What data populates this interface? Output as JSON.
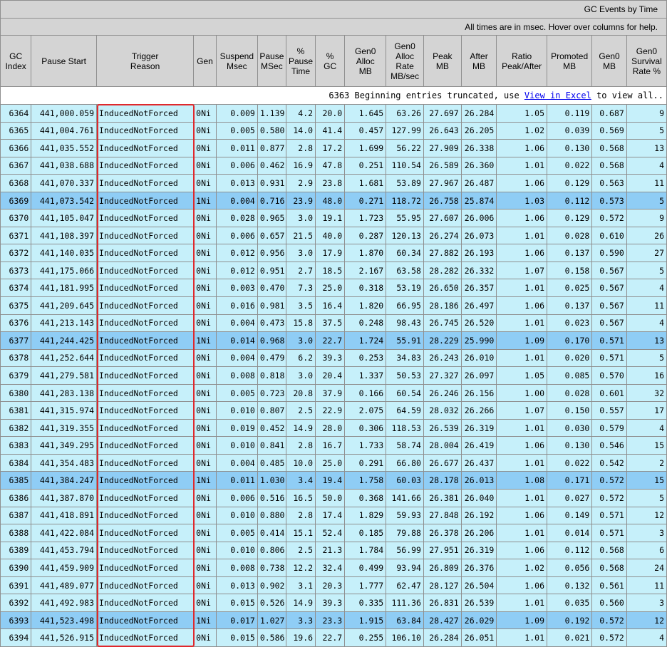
{
  "header": {
    "title": "GC Events by Time",
    "subtitle": "All times are in msec. Hover over columns for help."
  },
  "columns": [
    "GC\nIndex",
    "Pause Start",
    "Trigger\nReason",
    "Gen",
    "Suspend\nMsec",
    "Pause\nMSec",
    "%\nPause\nTime",
    "%\nGC",
    "Gen0\nAlloc\nMB",
    "Gen0\nAlloc\nRate\nMB/sec",
    "Peak\nMB",
    "After\nMB",
    "Ratio\nPeak/After",
    "Promoted\nMB",
    "Gen0\nMB",
    "Gen0\nSurvival\nRate %"
  ],
  "note": {
    "prefix": "6363 Beginning entries truncated, use ",
    "link": "View in Excel",
    "suffix": " to view all.."
  },
  "rows": [
    [
      "6364",
      "441,000.059",
      "InducedNotForced",
      "0Ni",
      "0.009",
      "1.139",
      "4.2",
      "20.0",
      "1.645",
      "63.26",
      "27.697",
      "26.284",
      "1.05",
      "0.119",
      "0.687",
      "9"
    ],
    [
      "6365",
      "441,004.761",
      "InducedNotForced",
      "0Ni",
      "0.005",
      "0.580",
      "14.0",
      "41.4",
      "0.457",
      "127.99",
      "26.643",
      "26.205",
      "1.02",
      "0.039",
      "0.569",
      "5"
    ],
    [
      "6366",
      "441,035.552",
      "InducedNotForced",
      "0Ni",
      "0.011",
      "0.877",
      "2.8",
      "17.2",
      "1.699",
      "56.22",
      "27.909",
      "26.338",
      "1.06",
      "0.130",
      "0.568",
      "13"
    ],
    [
      "6367",
      "441,038.688",
      "InducedNotForced",
      "0Ni",
      "0.006",
      "0.462",
      "16.9",
      "47.8",
      "0.251",
      "110.54",
      "26.589",
      "26.360",
      "1.01",
      "0.022",
      "0.568",
      "4"
    ],
    [
      "6368",
      "441,070.337",
      "InducedNotForced",
      "0Ni",
      "0.013",
      "0.931",
      "2.9",
      "23.8",
      "1.681",
      "53.89",
      "27.967",
      "26.487",
      "1.06",
      "0.129",
      "0.563",
      "11"
    ],
    [
      "6369",
      "441,073.542",
      "InducedNotForced",
      "1Ni",
      "0.004",
      "0.716",
      "23.9",
      "48.0",
      "0.271",
      "118.72",
      "26.758",
      "25.874",
      "1.03",
      "0.112",
      "0.573",
      "5"
    ],
    [
      "6370",
      "441,105.047",
      "InducedNotForced",
      "0Ni",
      "0.028",
      "0.965",
      "3.0",
      "19.1",
      "1.723",
      "55.95",
      "27.607",
      "26.006",
      "1.06",
      "0.129",
      "0.572",
      "9"
    ],
    [
      "6371",
      "441,108.397",
      "InducedNotForced",
      "0Ni",
      "0.006",
      "0.657",
      "21.5",
      "40.0",
      "0.287",
      "120.13",
      "26.274",
      "26.073",
      "1.01",
      "0.028",
      "0.610",
      "26"
    ],
    [
      "6372",
      "441,140.035",
      "InducedNotForced",
      "0Ni",
      "0.012",
      "0.956",
      "3.0",
      "17.9",
      "1.870",
      "60.34",
      "27.882",
      "26.193",
      "1.06",
      "0.137",
      "0.590",
      "27"
    ],
    [
      "6373",
      "441,175.066",
      "InducedNotForced",
      "0Ni",
      "0.012",
      "0.951",
      "2.7",
      "18.5",
      "2.167",
      "63.58",
      "28.282",
      "26.332",
      "1.07",
      "0.158",
      "0.567",
      "5"
    ],
    [
      "6374",
      "441,181.995",
      "InducedNotForced",
      "0Ni",
      "0.003",
      "0.470",
      "7.3",
      "25.0",
      "0.318",
      "53.19",
      "26.650",
      "26.357",
      "1.01",
      "0.025",
      "0.567",
      "4"
    ],
    [
      "6375",
      "441,209.645",
      "InducedNotForced",
      "0Ni",
      "0.016",
      "0.981",
      "3.5",
      "16.4",
      "1.820",
      "66.95",
      "28.186",
      "26.497",
      "1.06",
      "0.137",
      "0.567",
      "11"
    ],
    [
      "6376",
      "441,213.143",
      "InducedNotForced",
      "0Ni",
      "0.004",
      "0.473",
      "15.8",
      "37.5",
      "0.248",
      "98.43",
      "26.745",
      "26.520",
      "1.01",
      "0.023",
      "0.567",
      "4"
    ],
    [
      "6377",
      "441,244.425",
      "InducedNotForced",
      "1Ni",
      "0.014",
      "0.968",
      "3.0",
      "22.7",
      "1.724",
      "55.91",
      "28.229",
      "25.990",
      "1.09",
      "0.170",
      "0.571",
      "13"
    ],
    [
      "6378",
      "441,252.644",
      "InducedNotForced",
      "0Ni",
      "0.004",
      "0.479",
      "6.2",
      "39.3",
      "0.253",
      "34.83",
      "26.243",
      "26.010",
      "1.01",
      "0.020",
      "0.571",
      "5"
    ],
    [
      "6379",
      "441,279.581",
      "InducedNotForced",
      "0Ni",
      "0.008",
      "0.818",
      "3.0",
      "20.4",
      "1.337",
      "50.53",
      "27.327",
      "26.097",
      "1.05",
      "0.085",
      "0.570",
      "16"
    ],
    [
      "6380",
      "441,283.138",
      "InducedNotForced",
      "0Ni",
      "0.005",
      "0.723",
      "20.8",
      "37.9",
      "0.166",
      "60.54",
      "26.246",
      "26.156",
      "1.00",
      "0.028",
      "0.601",
      "32"
    ],
    [
      "6381",
      "441,315.974",
      "InducedNotForced",
      "0Ni",
      "0.010",
      "0.807",
      "2.5",
      "22.9",
      "2.075",
      "64.59",
      "28.032",
      "26.266",
      "1.07",
      "0.150",
      "0.557",
      "17"
    ],
    [
      "6382",
      "441,319.355",
      "InducedNotForced",
      "0Ni",
      "0.019",
      "0.452",
      "14.9",
      "28.0",
      "0.306",
      "118.53",
      "26.539",
      "26.319",
      "1.01",
      "0.030",
      "0.579",
      "4"
    ],
    [
      "6383",
      "441,349.295",
      "InducedNotForced",
      "0Ni",
      "0.010",
      "0.841",
      "2.8",
      "16.7",
      "1.733",
      "58.74",
      "28.004",
      "26.419",
      "1.06",
      "0.130",
      "0.546",
      "15"
    ],
    [
      "6384",
      "441,354.483",
      "InducedNotForced",
      "0Ni",
      "0.004",
      "0.485",
      "10.0",
      "25.0",
      "0.291",
      "66.80",
      "26.677",
      "26.437",
      "1.01",
      "0.022",
      "0.542",
      "2"
    ],
    [
      "6385",
      "441,384.247",
      "InducedNotForced",
      "1Ni",
      "0.011",
      "1.030",
      "3.4",
      "19.4",
      "1.758",
      "60.03",
      "28.178",
      "26.013",
      "1.08",
      "0.171",
      "0.572",
      "15"
    ],
    [
      "6386",
      "441,387.870",
      "InducedNotForced",
      "0Ni",
      "0.006",
      "0.516",
      "16.5",
      "50.0",
      "0.368",
      "141.66",
      "26.381",
      "26.040",
      "1.01",
      "0.027",
      "0.572",
      "5"
    ],
    [
      "6387",
      "441,418.891",
      "InducedNotForced",
      "0Ni",
      "0.010",
      "0.880",
      "2.8",
      "17.4",
      "1.829",
      "59.93",
      "27.848",
      "26.192",
      "1.06",
      "0.149",
      "0.571",
      "12"
    ],
    [
      "6388",
      "441,422.084",
      "InducedNotForced",
      "0Ni",
      "0.005",
      "0.414",
      "15.1",
      "52.4",
      "0.185",
      "79.88",
      "26.378",
      "26.206",
      "1.01",
      "0.014",
      "0.571",
      "3"
    ],
    [
      "6389",
      "441,453.794",
      "InducedNotForced",
      "0Ni",
      "0.010",
      "0.806",
      "2.5",
      "21.3",
      "1.784",
      "56.99",
      "27.951",
      "26.319",
      "1.06",
      "0.112",
      "0.568",
      "6"
    ],
    [
      "6390",
      "441,459.909",
      "InducedNotForced",
      "0Ni",
      "0.008",
      "0.738",
      "12.2",
      "32.4",
      "0.499",
      "93.94",
      "26.809",
      "26.376",
      "1.02",
      "0.056",
      "0.568",
      "24"
    ],
    [
      "6391",
      "441,489.077",
      "InducedNotForced",
      "0Ni",
      "0.013",
      "0.902",
      "3.1",
      "20.3",
      "1.777",
      "62.47",
      "28.127",
      "26.504",
      "1.06",
      "0.132",
      "0.561",
      "11"
    ],
    [
      "6392",
      "441,492.983",
      "InducedNotForced",
      "0Ni",
      "0.015",
      "0.526",
      "14.9",
      "39.3",
      "0.335",
      "111.36",
      "26.831",
      "26.539",
      "1.01",
      "0.035",
      "0.560",
      "3"
    ],
    [
      "6393",
      "441,523.498",
      "InducedNotForced",
      "1Ni",
      "0.017",
      "1.027",
      "3.3",
      "23.3",
      "1.915",
      "63.84",
      "28.427",
      "26.029",
      "1.09",
      "0.192",
      "0.572",
      "12"
    ],
    [
      "6394",
      "441,526.915",
      "InducedNotForced",
      "0Ni",
      "0.015",
      "0.586",
      "19.6",
      "22.7",
      "0.255",
      "106.10",
      "26.284",
      "26.051",
      "1.01",
      "0.021",
      "0.572",
      "4"
    ]
  ],
  "colors": {
    "header_bg": "#d4d4d4",
    "row_gen0": "#c6f0fa",
    "row_gen1": "#8fcdf5",
    "highlight_border": "#e0282c",
    "link": "#0000ee"
  }
}
